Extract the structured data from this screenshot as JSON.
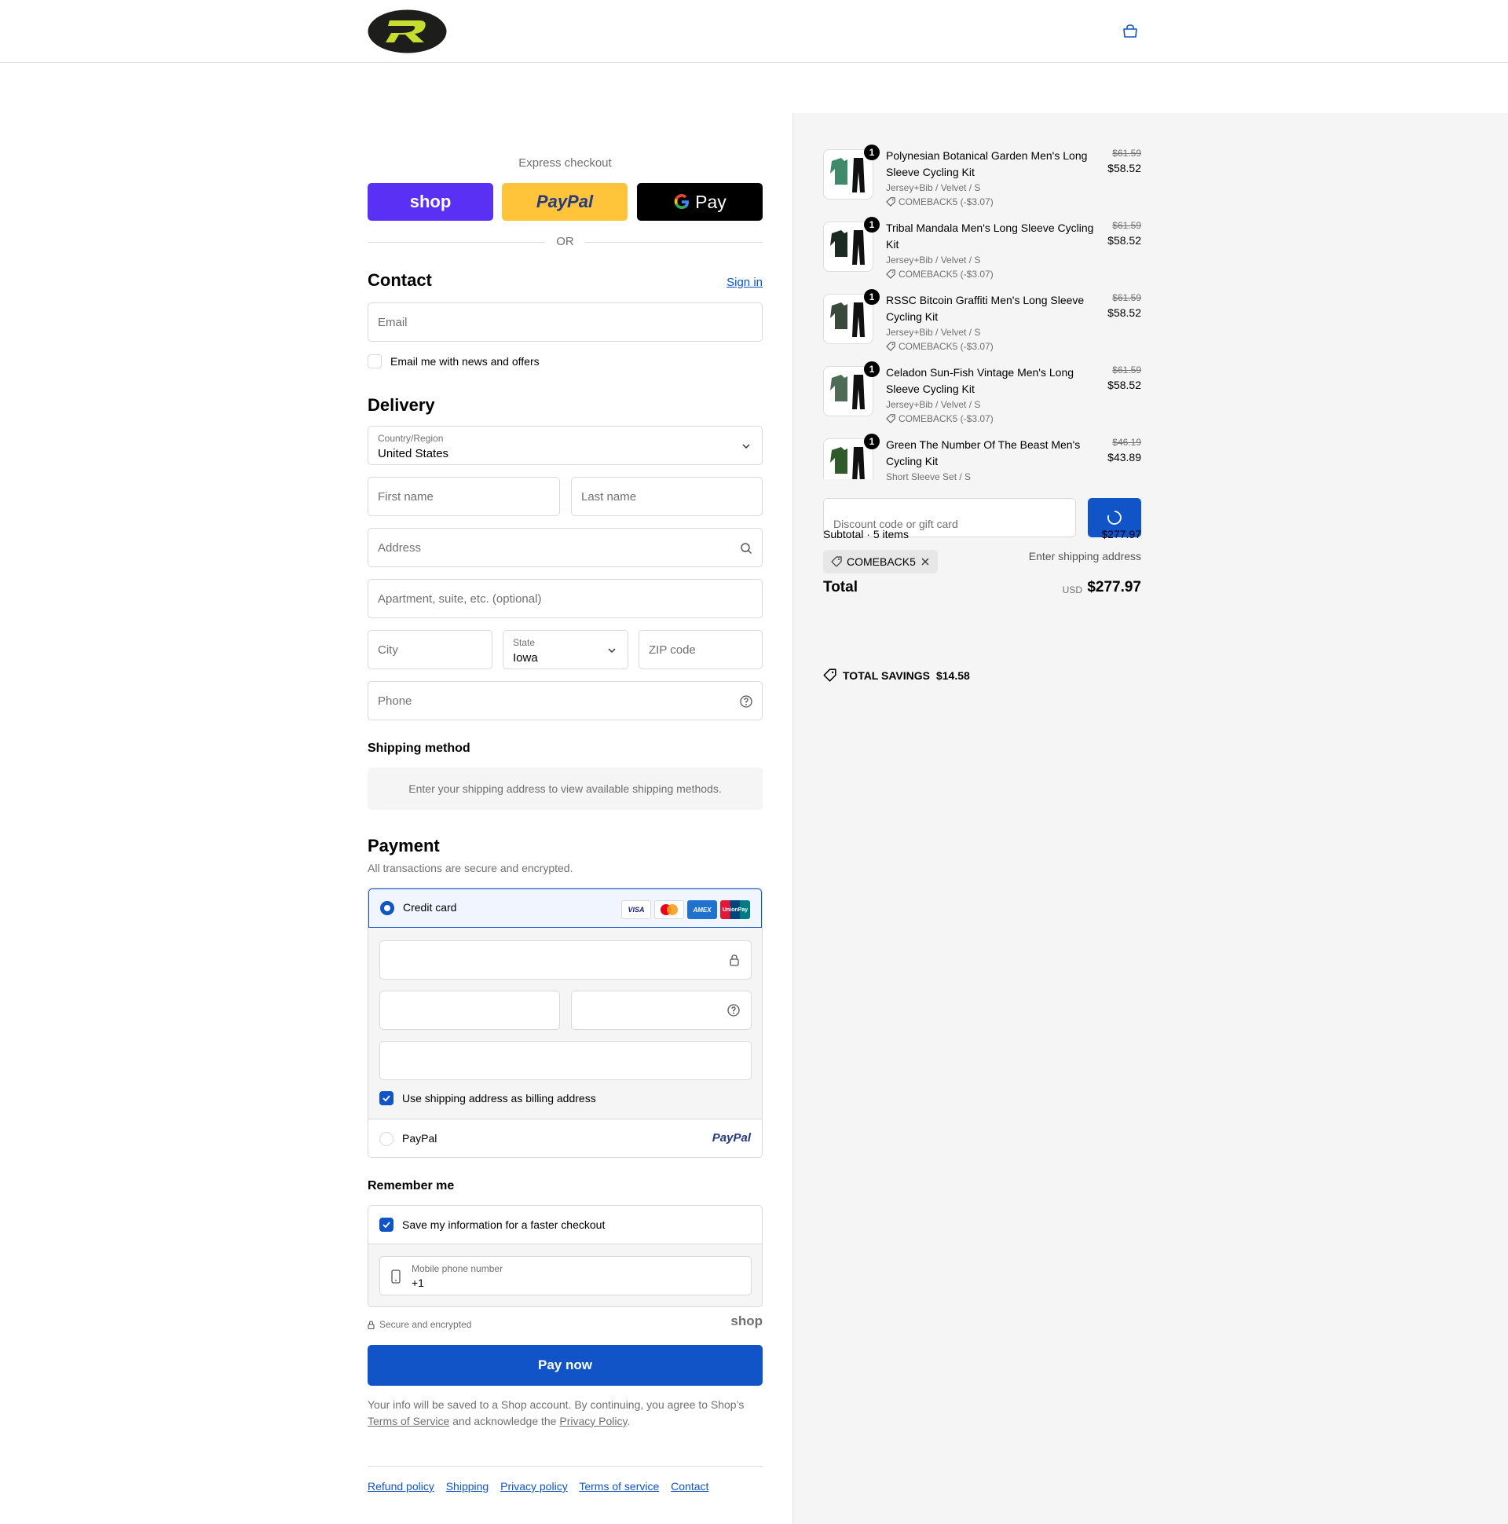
{
  "header": {
    "logo": "R-logo",
    "bag_icon": "shopping-bag-icon"
  },
  "express": {
    "label": "Express checkout",
    "shop_label": "shop",
    "paypal_label": "PayPal",
    "gpay_label": "Pay",
    "or_label": "OR"
  },
  "contact": {
    "title": "Contact",
    "sign_in": "Sign in",
    "email_placeholder": "Email",
    "newsletter_label": "Email me with news and offers"
  },
  "delivery": {
    "title": "Delivery",
    "country_label": "Country/Region",
    "country_value": "United States",
    "first_name_placeholder": "First name",
    "last_name_placeholder": "Last name",
    "address_placeholder": "Address",
    "apartment_placeholder": "Apartment, suite, etc. (optional)",
    "city_placeholder": "City",
    "state_label": "State",
    "state_value": "Iowa",
    "zip_placeholder": "ZIP code",
    "phone_placeholder": "Phone"
  },
  "shipping": {
    "title": "Shipping method",
    "notice": "Enter your shipping address to view available shipping methods."
  },
  "payment": {
    "title": "Payment",
    "subtitle": "All transactions are secure and encrypted.",
    "credit_card_label": "Credit card",
    "cards": [
      "VISA",
      "MC",
      "AMEX",
      "UnionPay"
    ],
    "billing_label": "Use shipping address as billing address",
    "paypal_label": "PayPal",
    "paypal_logo": "PayPal"
  },
  "remember": {
    "title": "Remember me",
    "save_label": "Save my information for a faster checkout",
    "mobile_label": "Mobile phone number",
    "mobile_value": "+1",
    "secure_label": "Secure and encrypted",
    "shop_logo": "shop"
  },
  "pay_now": "Pay now",
  "legal": {
    "text1": "Your info will be saved to a Shop account. By continuing, you agree to Shop’s",
    "tos": "Terms of Service",
    "text2": "and acknowledge the",
    "privacy": "Privacy Policy",
    "end": "."
  },
  "footer_links": [
    "Refund policy",
    "Shipping",
    "Privacy policy",
    "Terms of service",
    "Contact"
  ],
  "summary": {
    "items": [
      {
        "qty": "1",
        "name": "Polynesian Botanical Garden Men's Long Sleeve Cycling Kit",
        "variant": "Jersey+Bib / Velvet / S",
        "discount": "COMEBACK5 (-$3.07)",
        "old_price": "$61.59",
        "price": "$58.52"
      },
      {
        "qty": "1",
        "name": "Tribal Mandala Men's Long Sleeve Cycling Kit",
        "variant": "Jersey+Bib / Velvet / S",
        "discount": "COMEBACK5 (-$3.07)",
        "old_price": "$61.59",
        "price": "$58.52"
      },
      {
        "qty": "1",
        "name": "RSSC Bitcoin Graffiti Men's Long Sleeve Cycling Kit",
        "variant": "Jersey+Bib / Velvet / S",
        "discount": "COMEBACK5 (-$3.07)",
        "old_price": "$61.59",
        "price": "$58.52"
      },
      {
        "qty": "1",
        "name": "Celadon Sun-Fish Vintage Men's Long Sleeve Cycling Kit",
        "variant": "Jersey+Bib / Velvet / S",
        "discount": "COMEBACK5 (-$3.07)",
        "old_price": "$61.59",
        "price": "$58.52"
      },
      {
        "qty": "1",
        "name": "Green The Number Of The Beast Men's Cycling Kit",
        "variant": "Short Sleeve Set / S",
        "discount": "",
        "old_price": "$46.19",
        "price": "$43.89"
      }
    ],
    "discount_placeholder": "Discount code or gift card",
    "subtotal_label": "Subtotal · 5 items",
    "subtotal_value": "$277.97",
    "code_tag": "COMEBACK5",
    "shipping_hint": "Enter shipping address",
    "total_label": "Total",
    "currency": "USD",
    "total_value": "$277.97",
    "savings_label": "TOTAL SAVINGS",
    "savings_value": "$14.58"
  },
  "colors": {
    "accent": "#1054c7",
    "shop": "#5a31f4",
    "paypal": "#ffc439",
    "logo_green": "#c6dc2e"
  }
}
